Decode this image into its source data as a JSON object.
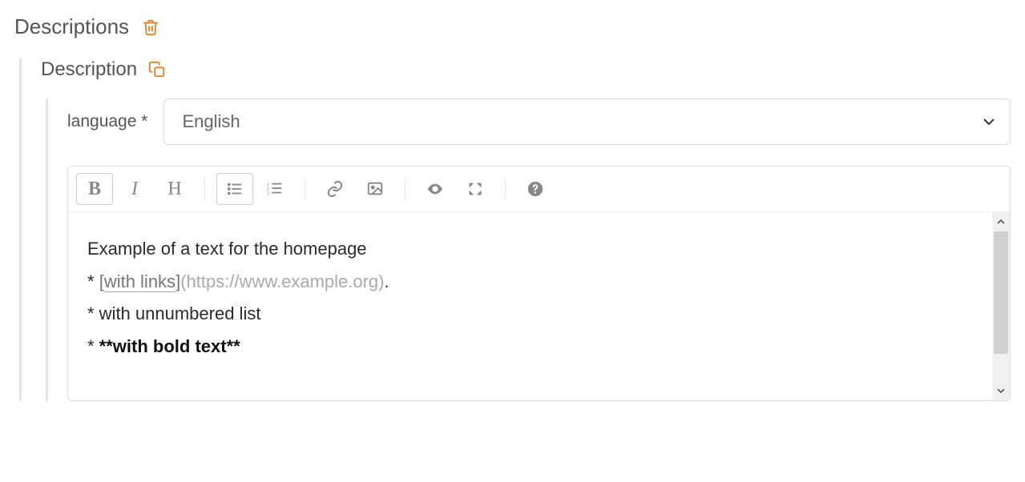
{
  "colors": {
    "accent": "#e67e22"
  },
  "section": {
    "title": "Descriptions"
  },
  "item": {
    "title": "Description",
    "language_label": "language *",
    "language_value": "English"
  },
  "toolbar": {
    "bold": "B",
    "italic": "I",
    "heading": "H"
  },
  "editor": {
    "line1": "Example of a text for the homepage",
    "line2": {
      "prefix": "* ",
      "bracket_open": "[",
      "link_text": "with links",
      "bracket_close": "]",
      "url_wrapped": "(https://www.example.org)",
      "suffix": "."
    },
    "line3": "* with unnumbered list",
    "line4": {
      "prefix": "* ",
      "bold_text": "**with bold text**"
    }
  }
}
